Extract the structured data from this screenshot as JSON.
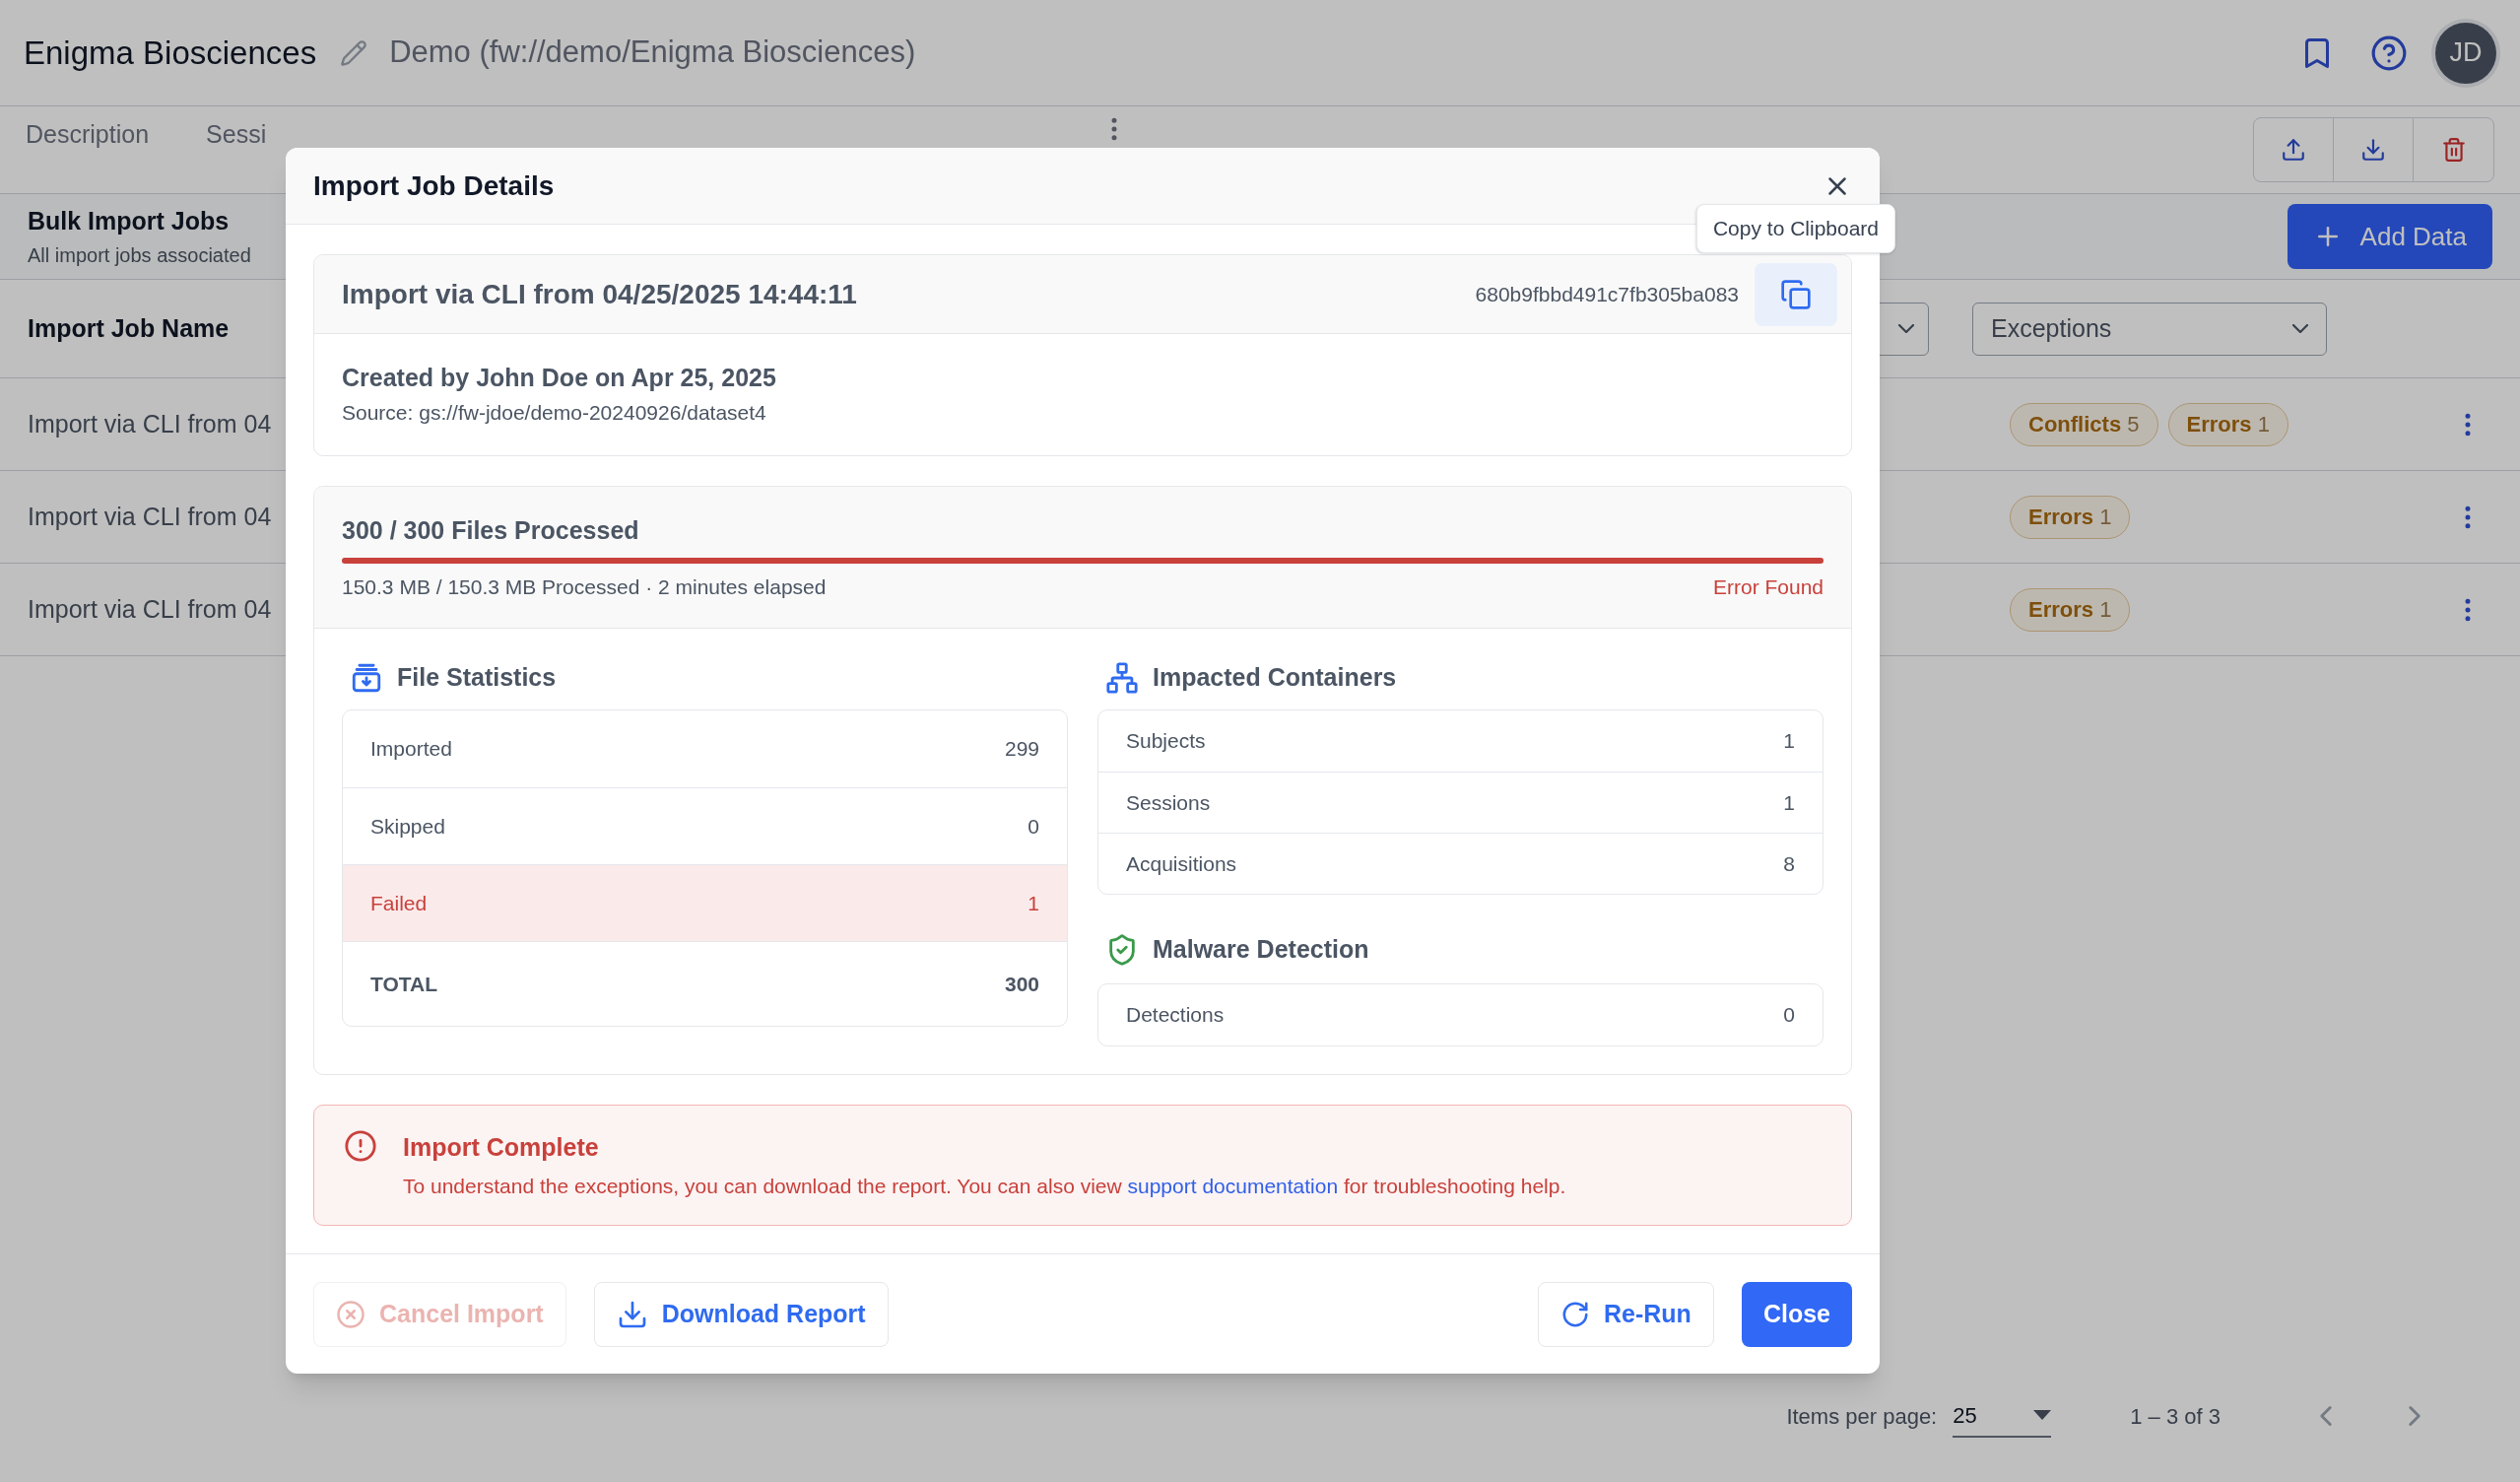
{
  "header": {
    "project": "Enigma Biosciences",
    "path": "Demo (fw://demo/Enigma Biosciences)",
    "avatar": "JD"
  },
  "tabs": [
    {
      "label": "Description"
    },
    {
      "label": "Sessi"
    }
  ],
  "page": {
    "title": "Bulk Import Jobs",
    "subtitle": "All import jobs associated",
    "add_button": "Add Data",
    "column_header": "Import Job Name",
    "filter": "Exceptions"
  },
  "jobs": [
    {
      "name": "Import via CLI from 04",
      "badges": [
        {
          "label": "Conflicts",
          "count": "5"
        },
        {
          "label": "Errors",
          "count": "1"
        }
      ]
    },
    {
      "name": "Import via CLI from 04",
      "badges": [
        {
          "label": "Errors",
          "count": "1"
        }
      ]
    },
    {
      "name": "Import via CLI from 04",
      "badges": [
        {
          "label": "Errors",
          "count": "1"
        }
      ]
    }
  ],
  "pagination": {
    "label": "Items per page:",
    "page_size": "25",
    "range": "1 – 3 of 3"
  },
  "dialog": {
    "title": "Import Job Details",
    "job": {
      "name": "Import via CLI from 04/25/2025 14:44:11",
      "id": "680b9fbbd491c7fb305ba083",
      "tooltip": "Copy to Clipboard",
      "created": "Created by John Doe on Apr 25, 2025",
      "source": "Source: gs://fw-jdoe/demo-20240926/dataset4"
    },
    "progress": {
      "title": "300 / 300 Files Processed",
      "level": 1,
      "error": true,
      "detail": "150.3 MB / 150.3 MB Processed · 2 minutes elapsed",
      "status": "Error Found"
    },
    "file_statistics": {
      "title": "File Statistics",
      "rows": [
        {
          "label": "Imported",
          "value": "299",
          "kind": "normal"
        },
        {
          "label": "Skipped",
          "value": "0",
          "kind": "normal"
        },
        {
          "label": "Failed",
          "value": "1",
          "kind": "failed"
        },
        {
          "label": "TOTAL",
          "value": "300",
          "kind": "total"
        }
      ]
    },
    "impacted_containers": {
      "title": "Impacted Containers",
      "rows": [
        {
          "label": "Subjects",
          "value": "1"
        },
        {
          "label": "Sessions",
          "value": "1"
        },
        {
          "label": "Acquisitions",
          "value": "8"
        }
      ]
    },
    "malware_detection": {
      "title": "Malware Detection",
      "rows": [
        {
          "label": "Detections",
          "value": "0"
        }
      ]
    },
    "alert": {
      "title": "Import Complete",
      "text_before": "To understand the exceptions, you can download the report. You can also view ",
      "link": "support documentation",
      "text_after": " for troubleshooting help."
    },
    "buttons": [
      {
        "label": "Cancel Import",
        "kind": "cancel",
        "disabled": true
      },
      {
        "label": "Download Report",
        "kind": "download",
        "disabled": false
      },
      {
        "label": "Re-Run",
        "kind": "rerun",
        "disabled": false
      },
      {
        "label": "Close",
        "kind": "primary",
        "disabled": false
      }
    ]
  }
}
